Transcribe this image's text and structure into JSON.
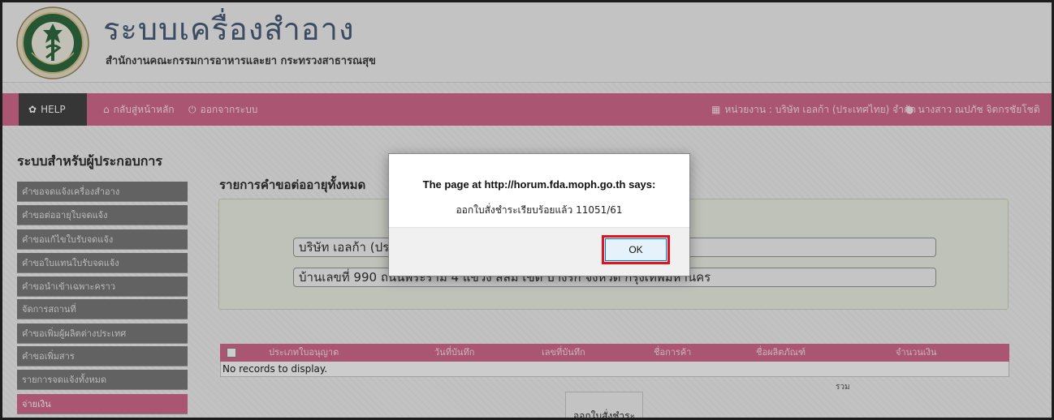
{
  "header": {
    "title": "ระบบเครื่องสำอาง",
    "subtitle": "สำนักงานคณะกรรมการอาหารและยา กระทรวงสาธารณสุข",
    "logo_icon": "ministry-of-public-health-seal"
  },
  "nav": {
    "help": "HELP",
    "home": "กลับสู่หน้าหลัก",
    "logout": "ออกจากระบบ",
    "agency": "หน่วยงาน : บริษัท เอลก้า (ประเทศไทย) จำกัด",
    "user": "นางสาว ณปภัช จิตกรชัยโชติ",
    "icons": {
      "help": "gear-icon",
      "home": "home-icon",
      "logout": "power-icon",
      "agency": "building-icon",
      "user": "user-icon"
    }
  },
  "sidebar": {
    "title": "ระบบสำหรับผู้ประกอบการ",
    "items": [
      "คำขอจดแจ้งเครื่องสำอาง",
      "คำขอต่ออายุใบจดแจ้ง",
      "คำขอแก้ไขใบรับจดแจ้ง",
      "คำขอใบแทนใบรับจดแจ้ง",
      "คำขอนำเข้าเฉพาะคราว",
      "จัดการสถานที่",
      "คำขอเพิ่มผู้ผลิตต่างประเทศ",
      "คำขอเพิ่มสาร",
      "รายการจดแจ้งทั้งหมด",
      "จ่ายเงิน"
    ],
    "active_index": 9
  },
  "main": {
    "title": "รายการคำขอต่ออายุทั้งหมด",
    "company": "บริษัท เอลก้า (ประเทศไทย) จำกัด",
    "address": "บ้านเลขที่ 990 ถนนพระราม 4 แขวง สีลม เขต บางรัก จังหวัด กรุงเทพมหานคร",
    "table": {
      "columns": [
        "ประเภทใบอนุญาต",
        "วันที่บันทึก",
        "เลขที่บันทึก",
        "ชื่อการค้า",
        "ชื่อผลิตภัณฑ์",
        "จำนวนเงิน"
      ],
      "empty": "No records to display."
    },
    "total_label": "รวม",
    "issue_button": "ออกใบสั่งชำระ"
  },
  "dialog": {
    "title": "The page at http://horum.fda.moph.go.th says:",
    "message": "ออกใบสั่งชำระเรียบร้อยแล้ว 11051/61",
    "ok": "OK"
  }
}
